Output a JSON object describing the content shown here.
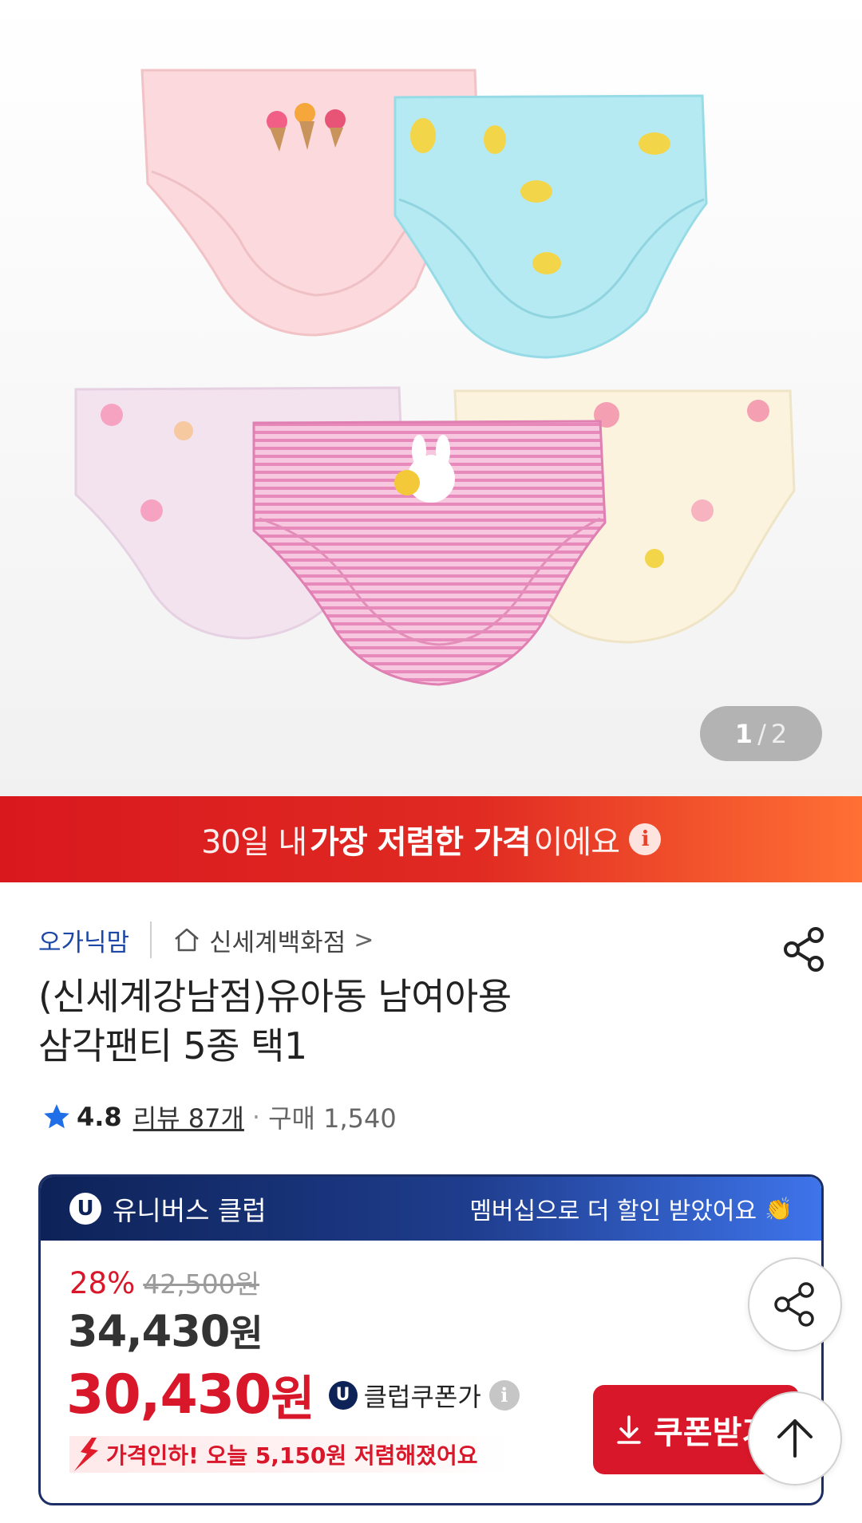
{
  "gallery": {
    "current": "1",
    "separator": "/",
    "total": "2"
  },
  "banner": {
    "prefix": "30일 내",
    "highlight": "가장 저렴한 가격",
    "suffix": "이에요",
    "info_icon": "info-icon"
  },
  "seller": {
    "brand": "오가닉맘",
    "store": "신세계백화점",
    "store_icon": "home-icon",
    "chevron": ">"
  },
  "product": {
    "title_line1": "(신세계강남점)유아동 남여아용",
    "title_line2": "삼각팬티 5종 택1",
    "rating": "4.8",
    "review": "리뷰 87개",
    "dot": "·",
    "purchase": "구매 1,540"
  },
  "club": {
    "badge": "U",
    "name": "유니버스 클럽",
    "message": "멤버십으로 더 할인 받았어요",
    "message_icon": "👏",
    "discount_rate": "28%",
    "original_price": "42,500원",
    "sale_price": "34,430",
    "sale_unit": "원",
    "coupon_price": "30,430",
    "coupon_unit": "원",
    "coupon_label": "클럽쿠폰가",
    "drop_text": "가격인하! 오늘 5,150원 저렴해졌어요",
    "coupon_button": "쿠폰받기"
  },
  "colors": {
    "accent_red": "#d8182a",
    "brand_navy": "#0d2257",
    "brand_blue": "#1d48a8"
  }
}
